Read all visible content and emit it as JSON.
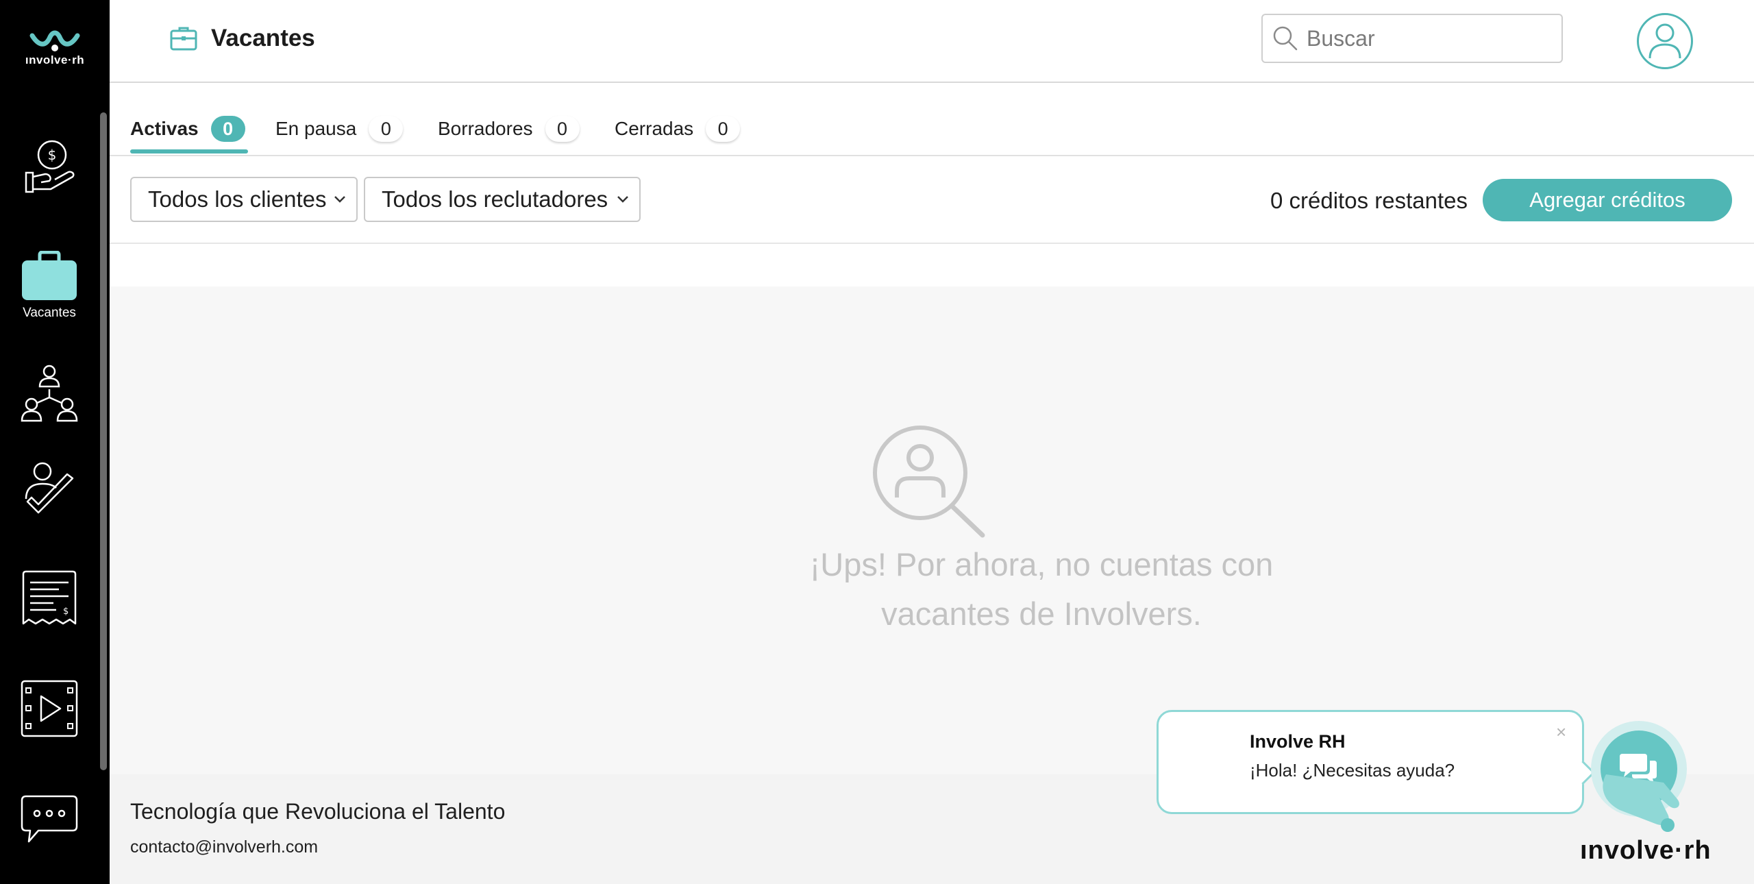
{
  "sidebar": {
    "logo_text": "ınvolve·rh",
    "items": [
      {
        "icon": "money-hand-icon",
        "label": ""
      },
      {
        "icon": "briefcase-icon",
        "label": "Vacantes",
        "active": true
      },
      {
        "icon": "team-network-icon",
        "label": ""
      },
      {
        "icon": "user-check-icon",
        "label": ""
      },
      {
        "icon": "invoice-icon",
        "label": ""
      },
      {
        "icon": "video-icon",
        "label": ""
      },
      {
        "icon": "chat-dots-icon",
        "label": ""
      }
    ]
  },
  "header": {
    "title": "Vacantes",
    "title_icon": "briefcase-outline-icon",
    "search_placeholder": "Buscar",
    "avatar_icon": "user-icon"
  },
  "tabs": [
    {
      "label": "Activas",
      "count": "0",
      "active": true
    },
    {
      "label": "En pausa",
      "count": "0"
    },
    {
      "label": "Borradores",
      "count": "0"
    },
    {
      "label": "Cerradas",
      "count": "0"
    }
  ],
  "filters": {
    "clients_selected": "Todos los clientes",
    "recruiters_selected": "Todos los reclutadores",
    "credits_text": "0 créditos restantes",
    "add_credits_label": "Agregar créditos"
  },
  "empty_state": {
    "icon": "user-search-icon",
    "line1": "¡Ups! Por ahora, no cuentas con",
    "line2": "vacantes de Involvers."
  },
  "footer": {
    "tagline": "Tecnología que Revoluciona el Talento",
    "email": "contacto@involverh.com"
  },
  "chat": {
    "name": "Involve RH",
    "message": "¡Hola! ¿Necesitas ayuda?",
    "close_symbol": "×",
    "brand": "ınvolve·rh"
  },
  "colors": {
    "accent": "#4fb6b4",
    "sidebar_bg": "#000000",
    "empty_text": "#c3c3c3"
  }
}
